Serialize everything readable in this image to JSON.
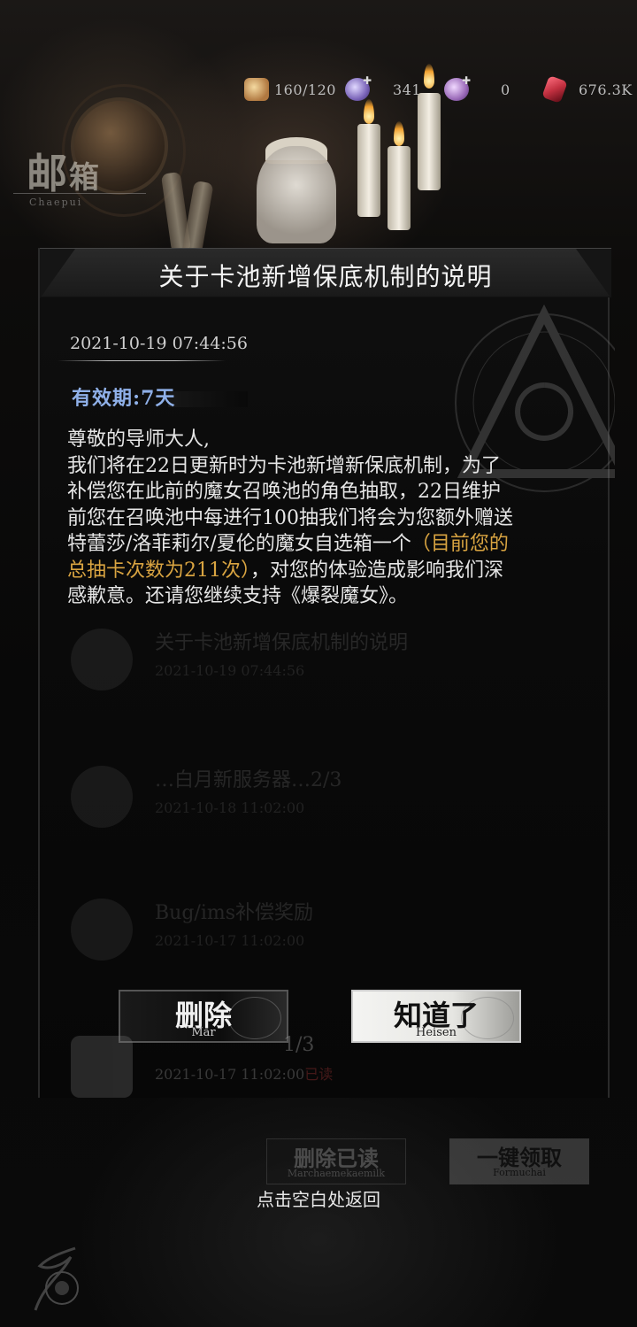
{
  "resources": [
    {
      "icon": "stamina-icon",
      "value": "160/120",
      "color": "#c9a06a"
    },
    {
      "icon": "crystal-icon",
      "value": "341",
      "color": "#8e7ac8"
    },
    {
      "icon": "premium-crystal-icon",
      "value": "0",
      "color": "#9a6ab8"
    },
    {
      "icon": "ruby-icon",
      "value": "676.3K",
      "color": "#c23040"
    }
  ],
  "mailbox": {
    "title_main": "邮",
    "title_small": "箱",
    "subtitle": "Chaepui"
  },
  "faded_list": [
    {
      "title": "关于卡池新增保底机制的说明",
      "date": "2021-10-19 07:44:56"
    },
    {
      "title": "…白月新服务器…2/3",
      "date": "2021-10-18 11:02:00"
    },
    {
      "title": "Bug/ims补偿奖励",
      "date": "2021-10-17 11:02:00"
    }
  ],
  "faded_last": {
    "title": "1/3",
    "date": "2021-10-17 11:02:00",
    "status": "已读"
  },
  "dialog": {
    "title": "关于卡池新增保底机制的说明",
    "date": "2021-10-19 07:44:56",
    "validity": "有效期:7天",
    "body_lines": [
      "尊敬的导师大人,",
      "我们将在22日更新时为卡池新增新保底机制，为了",
      "补偿您在此前的魔女召唤池的角色抽取，22日维护",
      "前您在召唤池中每进行100抽我们将会为您额外赠送"
    ],
    "line5_pre": "特蕾莎/洛菲莉尔/夏伦的魔女自选箱一个",
    "line5_hl": "（目前您的",
    "line6_hl": "总抽卡次数为211次）",
    "line6_post": "，对您的体验造成影响我们深",
    "line7": "感歉意。还请您继续支持《爆裂魔女》。",
    "highlight_color": "#d9a441",
    "delete_label": "删除",
    "delete_sub": "Mar",
    "ok_label": "知道了",
    "ok_sub": "Heisen"
  },
  "bottom": {
    "delete_read_label": "删除已读",
    "delete_read_sub": "Marchaemekaemilk",
    "claim_all_label": "一键领取",
    "claim_all_sub": "Formuchai",
    "tap_return": "点击空白处返回"
  }
}
